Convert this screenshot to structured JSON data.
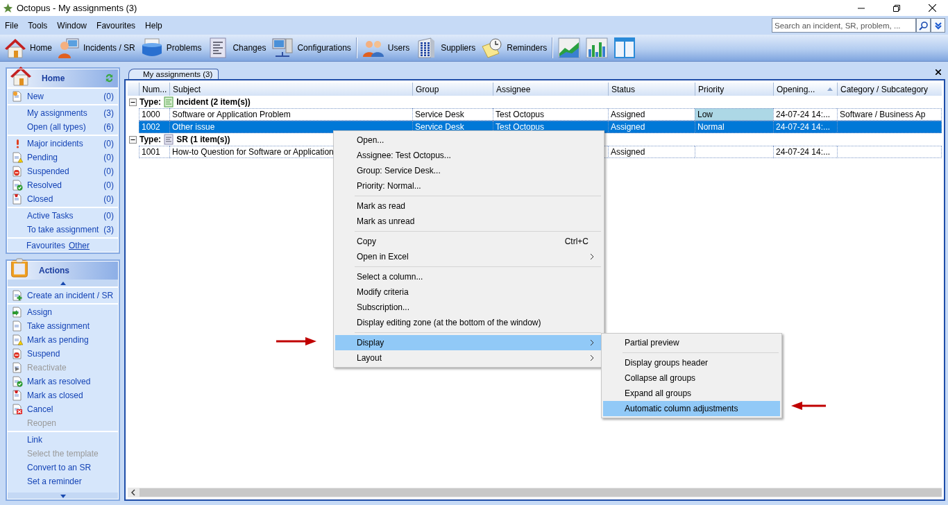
{
  "window": {
    "title": "Octopus - My assignments (3)"
  },
  "menu_bar": [
    "File",
    "Tools",
    "Window",
    "Favourites",
    "Help"
  ],
  "search": {
    "placeholder": "Search an incident, SR, problem, ..."
  },
  "toolbar": [
    [
      {
        "label": "Home",
        "kind": "home"
      },
      {
        "label": "Incidents / SR",
        "kind": "incidents"
      },
      {
        "label": "Problems",
        "kind": "problems"
      },
      {
        "label": "Changes",
        "kind": "changes"
      },
      {
        "label": "Configurations",
        "kind": "configurations"
      }
    ],
    [
      {
        "label": "Users",
        "kind": "users"
      },
      {
        "label": "Suppliers",
        "kind": "suppliers"
      },
      {
        "label": "Reminders",
        "kind": "reminders"
      }
    ],
    [
      {
        "kind": "line-chart"
      },
      {
        "kind": "bar-chart"
      },
      {
        "kind": "panes"
      }
    ]
  ],
  "home_panel": {
    "title": "Home",
    "sections": [
      [
        {
          "label": "New",
          "count": "(0)",
          "kind": "new"
        }
      ],
      [
        {
          "label": "My assignments",
          "count": "(3)",
          "kind": "none"
        },
        {
          "label": "Open (all types)",
          "count": "(6)",
          "kind": "none"
        }
      ],
      [
        {
          "label": "Major incidents",
          "count": "(0)",
          "kind": "major"
        },
        {
          "label": "Pending",
          "count": "(0)",
          "kind": "pending"
        },
        {
          "label": "Suspended",
          "count": "(0)",
          "kind": "suspended"
        },
        {
          "label": "Resolved",
          "count": "(0)",
          "kind": "resolved"
        },
        {
          "label": "Closed",
          "count": "(0)",
          "kind": "closed"
        }
      ],
      [
        {
          "label": "Active Tasks",
          "count": "(0)",
          "kind": "none"
        },
        {
          "label": "To take assignment",
          "count": "(3)",
          "kind": "none"
        }
      ]
    ],
    "favourites": "Favourites",
    "other_link": "Other"
  },
  "actions_panel": {
    "title": "Actions",
    "sections": [
      [
        {
          "label": "Create an incident / SR",
          "kind": "create",
          "disabled": false
        }
      ],
      [
        {
          "label": "Assign",
          "kind": "assign",
          "disabled": false
        },
        {
          "label": "Take assignment",
          "kind": "take",
          "disabled": false
        },
        {
          "label": "Mark as pending",
          "kind": "pending",
          "disabled": false
        },
        {
          "label": "Suspend",
          "kind": "suspended",
          "disabled": false
        },
        {
          "label": "Reactivate",
          "kind": "reactivate",
          "disabled": true
        },
        {
          "label": "Mark as resolved",
          "kind": "resolved",
          "disabled": false
        },
        {
          "label": "Mark as closed",
          "kind": "closed",
          "disabled": false
        },
        {
          "label": "Cancel",
          "kind": "cancel",
          "disabled": false
        },
        {
          "label": "Reopen",
          "kind": "none",
          "disabled": true
        }
      ],
      [
        {
          "label": "Link",
          "kind": "none",
          "disabled": false
        },
        {
          "label": "Select the template",
          "kind": "none",
          "disabled": true
        },
        {
          "label": "Convert to an SR",
          "kind": "none",
          "disabled": false
        },
        {
          "label": "Set a reminder",
          "kind": "none",
          "disabled": false
        }
      ]
    ]
  },
  "tabs": [
    {
      "label": "My assignments (3)",
      "selected": true
    }
  ],
  "table": {
    "columns": [
      {
        "label": "Num...",
        "sorted": false
      },
      {
        "label": "Subject",
        "sorted": false
      },
      {
        "label": "Group",
        "sorted": false
      },
      {
        "label": "Assignee",
        "sorted": false
      },
      {
        "label": "Status",
        "sorted": false
      },
      {
        "label": "Priority",
        "sorted": false
      },
      {
        "label": "Opening...",
        "sorted": true
      },
      {
        "label": "Category / Subcategory",
        "sorted": false
      }
    ],
    "groups": [
      {
        "prefix": "Type:",
        "name": "Incident (2 item(s))",
        "kind": "incident",
        "expanded": true,
        "rows": [
          {
            "num": "1000",
            "subject": "Software or Application Problem",
            "group": "Service Desk",
            "assignee": "Test Octopus",
            "status": "Assigned",
            "priority": {
              "text": "Low",
              "color": "#add8e6"
            },
            "opening": "24-07-24 14:...",
            "category": "Software / Business Ap",
            "selected": false
          },
          {
            "num": "1002",
            "subject": "Other issue",
            "group": "Service Desk",
            "assignee": "Test Octopus",
            "status": "Assigned",
            "priority": {
              "text": "Normal"
            },
            "opening": "24-07-24 14:...",
            "selected": true
          }
        ]
      },
      {
        "prefix": "Type:",
        "name": "SR (1 item(s))",
        "kind": "sr",
        "expanded": true,
        "rows": [
          {
            "num": "1001",
            "subject": "How-to Question for Software or Application",
            "status": "Assigned",
            "opening": "24-07-24 14:...",
            "selected": false
          }
        ]
      }
    ]
  },
  "context_menu": {
    "sections": [
      [
        {
          "label": "Open...",
          "submenu": false,
          "selected": false
        },
        {
          "label": "Assignee: Test Octopus...",
          "submenu": false,
          "selected": false
        },
        {
          "label": "Group: Service Desk...",
          "submenu": false,
          "selected": false
        },
        {
          "label": "Priority: Normal...",
          "submenu": false,
          "selected": false
        }
      ],
      [
        {
          "label": "Mark as read",
          "submenu": false,
          "selected": false
        },
        {
          "label": "Mark as unread",
          "submenu": false,
          "selected": false
        }
      ],
      [
        {
          "label": "Copy",
          "shortcut": "Ctrl+C",
          "submenu": false,
          "selected": false
        },
        {
          "label": "Open in Excel",
          "submenu": true,
          "selected": false
        }
      ],
      [
        {
          "label": "Select a column...",
          "submenu": false,
          "selected": false
        },
        {
          "label": "Modify criteria",
          "submenu": false,
          "selected": false
        },
        {
          "label": "Subscription...",
          "submenu": false,
          "selected": false
        },
        {
          "label": "Display editing zone (at the bottom of the window)",
          "submenu": false,
          "selected": false
        }
      ],
      [
        {
          "label": "Display",
          "submenu": true,
          "selected": true
        },
        {
          "label": "Layout",
          "submenu": true,
          "selected": false
        }
      ]
    ]
  },
  "submenu": {
    "sections": [
      [
        {
          "label": "Partial preview",
          "submenu": false,
          "selected": false
        }
      ],
      [
        {
          "label": "Display groups header",
          "submenu": false,
          "selected": false
        },
        {
          "label": "Collapse all groups",
          "submenu": false,
          "selected": false
        },
        {
          "label": "Expand all groups",
          "submenu": false,
          "selected": false
        },
        {
          "label": "Automatic column adjustments",
          "submenu": false,
          "selected": true
        }
      ]
    ]
  }
}
